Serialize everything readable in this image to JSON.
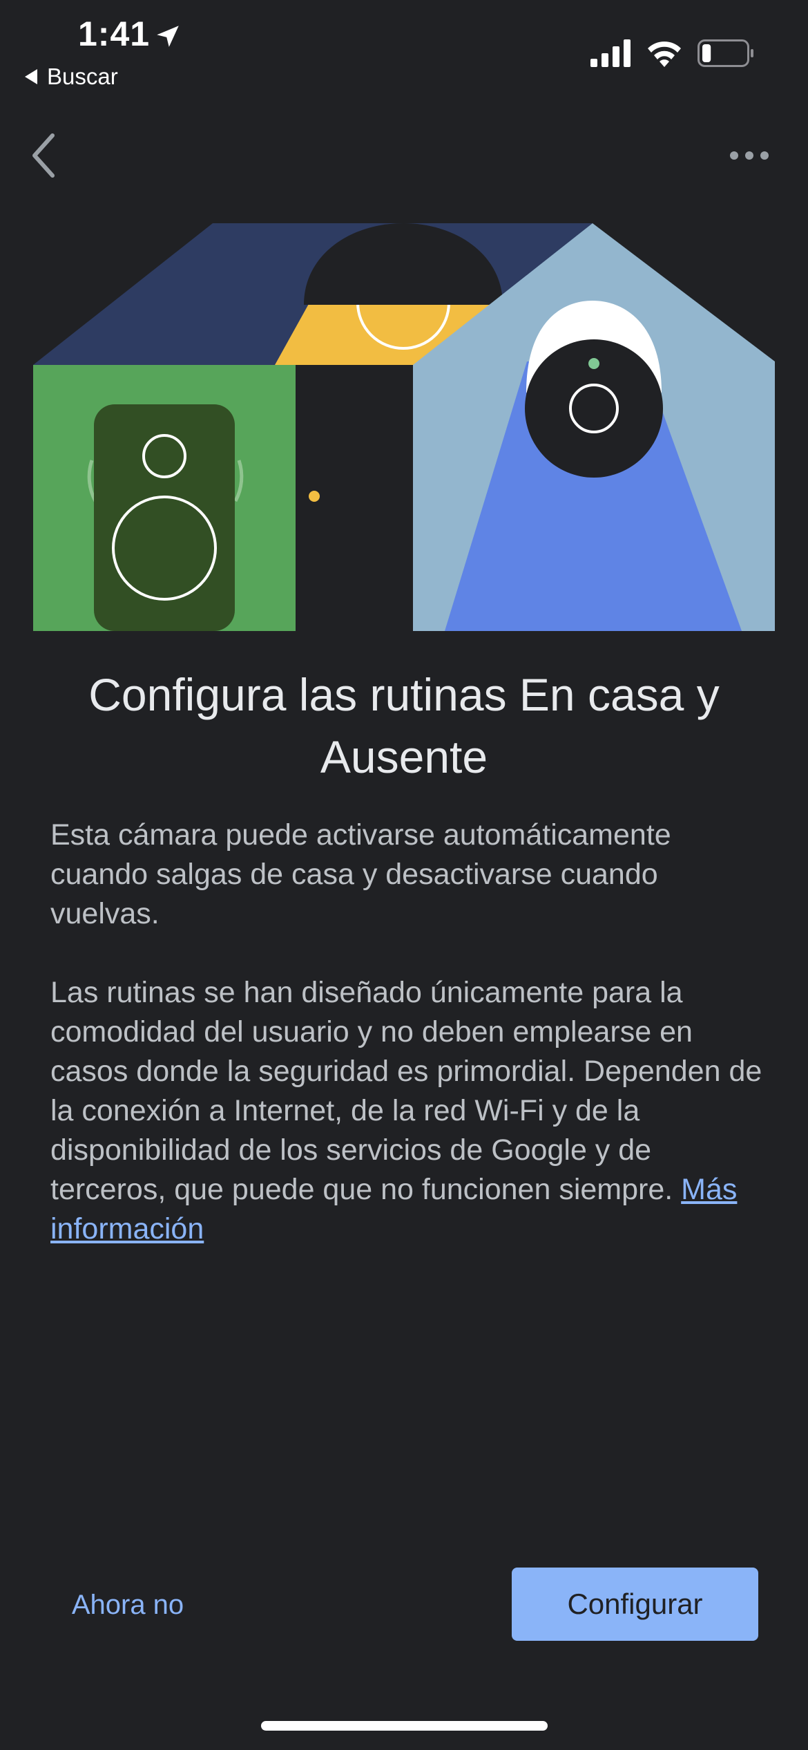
{
  "status_bar": {
    "time": "1:41",
    "back_app_label": "Buscar",
    "icons": [
      "location-arrow-icon",
      "signal-icon",
      "wifi-icon",
      "battery-icon"
    ],
    "battery_level": 0.2
  },
  "toolbar": {
    "icons": [
      "chevron-left-icon",
      "more-horizontal-icon"
    ]
  },
  "content": {
    "title": "Configura las rutinas En casa y Ausente",
    "paragraph1": "Esta cámara puede activarse automáticamente cuando salgas de casa y desactivarse cuando vuelvas.",
    "paragraph2": "Las rutinas se han diseñado únicamente para la comodidad del usuario y no deben emplearse en casos donde la seguridad es primordial. Dependen de la conexión a Internet, de la red Wi-Fi y de la disponibilidad de los servicios de Google y de terceros, que puede que no funcionen siempre.",
    "more_info_link": "Más información"
  },
  "actions": {
    "secondary_label": "Ahora no",
    "primary_label": "Configurar"
  },
  "colors": {
    "background": "#202124",
    "accent": "#8ab4f8",
    "roof_dark": "#2e3c62",
    "lamp_yellow": "#f2bd42",
    "speaker_room_green": "#57a55a",
    "speaker_dark": "#324f24",
    "camera_room_blue": "#93b6ce",
    "camera_beam": "#5f84e5"
  }
}
